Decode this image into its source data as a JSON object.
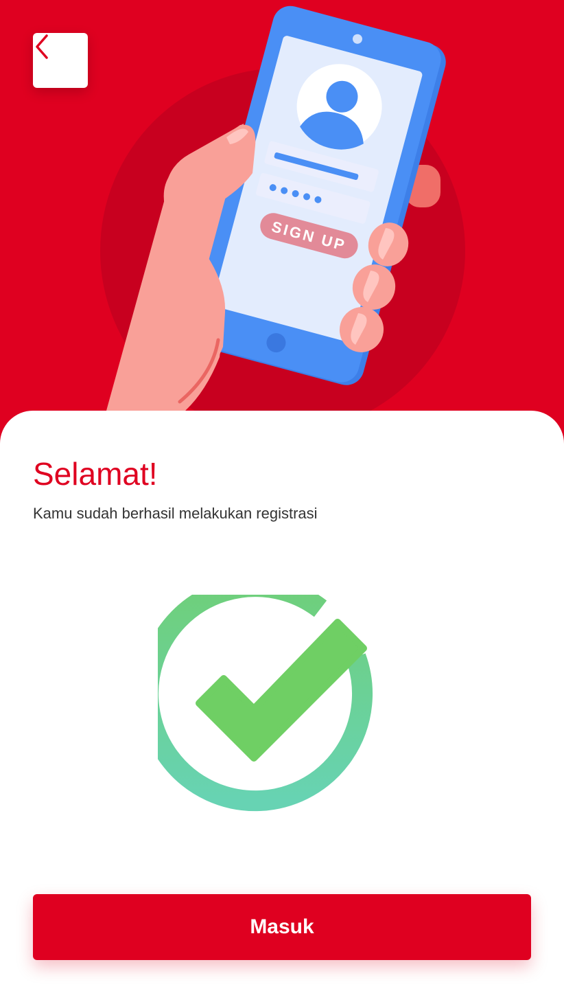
{
  "header": {
    "back_icon": "chevron-left-icon"
  },
  "illustration": {
    "button_text": "SIGN UP"
  },
  "content": {
    "title": "Selamat!",
    "subtitle": "Kamu sudah berhasil melakukan registrasi",
    "status_icon": "check-circle-icon"
  },
  "actions": {
    "primary_label": "Masuk"
  },
  "colors": {
    "brand_red": "#df0020",
    "success_green": "#6fcf64",
    "success_teal": "#67d3b3",
    "phone_blue": "#4a8ff5"
  }
}
